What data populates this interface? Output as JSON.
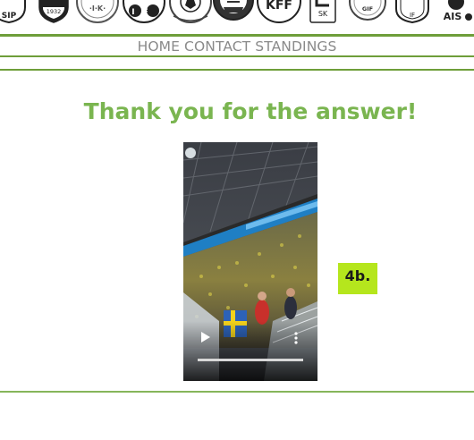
{
  "logos": [
    {
      "name": "club-crest-sip",
      "text": "SIP"
    },
    {
      "name": "club-crest-1932",
      "text": "1932"
    },
    {
      "name": "club-crest-ik",
      "text": "·I·K·"
    },
    {
      "name": "club-crest-if",
      "text": "IF"
    },
    {
      "name": "club-crest-football",
      "text": ""
    },
    {
      "name": "club-crest-dark-stripes",
      "text": ""
    },
    {
      "name": "club-crest-kff",
      "text": "KFF"
    },
    {
      "name": "club-crest-sk",
      "text": "SK"
    },
    {
      "name": "club-crest-sgif",
      "text": "GIF"
    },
    {
      "name": "club-crest-shield",
      "text": "IF"
    },
    {
      "name": "club-crest-ais",
      "text": "AIS"
    }
  ],
  "nav": {
    "home": "HOME",
    "contact": "CONTACT",
    "standings": "STANDINGS"
  },
  "headline": "Thank you for the answer!",
  "video": {
    "play_icon": "play-icon",
    "menu_icon": "more-vertical-icon",
    "progress": 1.0
  },
  "badge": "4b.",
  "colors": {
    "rule": "#6e9e3a",
    "headline": "#7ab550",
    "badge": "#b5e61d",
    "nav": "#8a8a8a"
  }
}
